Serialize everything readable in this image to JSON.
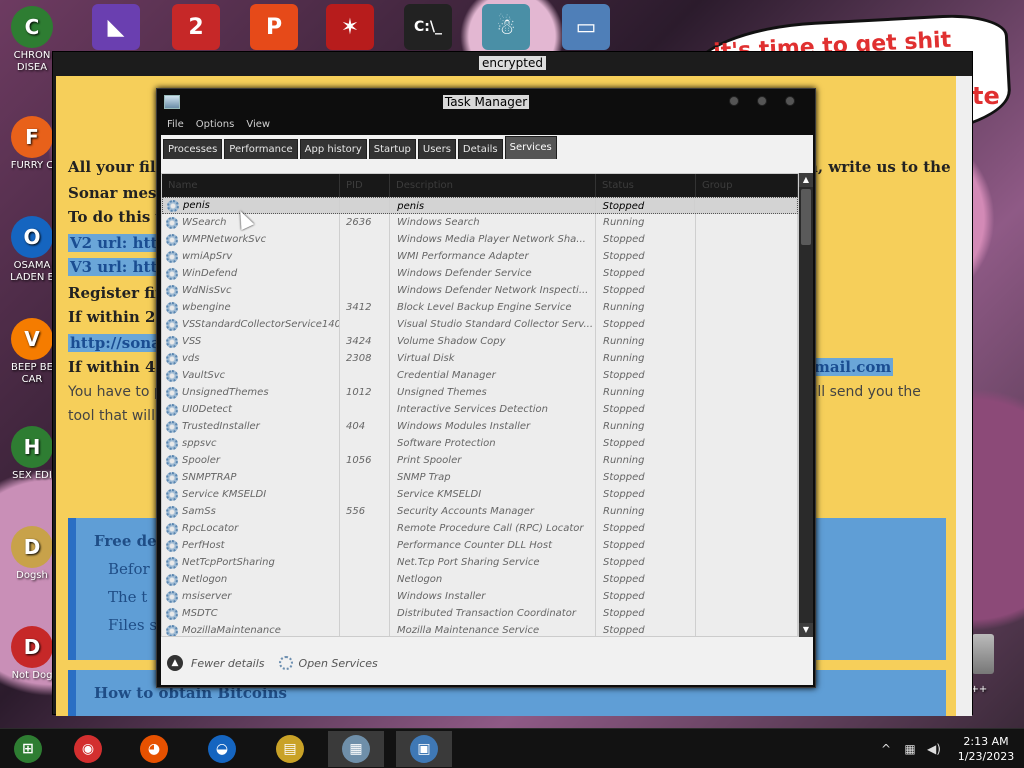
{
  "desktop": {
    "left_icons": [
      {
        "label": "CHRON\nDISEA",
        "icon": "chrome-icon",
        "color": "#2e7d32"
      },
      {
        "label": "FURRY C",
        "icon": "firefox-icon",
        "color": "#e8611a"
      },
      {
        "label": "OSAMA\nLADEN E",
        "icon": "obama-logo-icon",
        "color": "#1565c0"
      },
      {
        "label": "BEEP BE\nCAR",
        "icon": "vlc-cone-icon",
        "color": "#f57c00"
      },
      {
        "label": "SEX EDI",
        "icon": "hxd-icon",
        "color": "#2e7d32"
      },
      {
        "label": "Dogsh",
        "icon": "doge-icon",
        "color": "#c8a24a"
      },
      {
        "label": "Not Dog",
        "icon": "devcpp-icon",
        "color": "#c62828"
      }
    ],
    "top_icons": [
      {
        "name": "visual-studio-icon",
        "glyph": "◣",
        "color": "#6a3fb0"
      },
      {
        "name": "tf2-icon",
        "glyph": "2",
        "color": "#c62828"
      },
      {
        "name": "pinball-icon",
        "glyph": "P",
        "color": "#e64a19"
      },
      {
        "name": "bat-icon",
        "glyph": "✶",
        "color": "#b71c1c"
      },
      {
        "name": "cmd-icon",
        "glyph": "C:\\_",
        "color": "#222222"
      },
      {
        "name": "snowman-icon",
        "glyph": "☃",
        "color": "#4a8fa6"
      },
      {
        "name": "window-app-icon",
        "glyph": "▭",
        "color": "#4f7fb8"
      }
    ],
    "comic_text": "it's time to get shit",
    "right_labels": [
      "te",
      "n C++"
    ]
  },
  "ransom_window": {
    "title": "encrypted",
    "lines": [
      {
        "text": "All your file",
        "tail": "m, write us to the"
      },
      {
        "text": "Sonar messa"
      },
      {
        "text": "To do this yo"
      },
      {
        "text": "V2 url: http",
        "hl": true
      },
      {
        "text": "V3 url: http",
        "hl": true
      },
      {
        "text": "Register firs"
      },
      {
        "text": "If within 24"
      },
      {
        "text": "http://sona",
        "hl": true
      },
      {
        "text": "If within 48",
        "tail": "mail.com"
      },
      {
        "text": "You have to p",
        "tail": "will send you the"
      },
      {
        "text": "tool that will d"
      }
    ],
    "box1": {
      "title": "Free decr",
      "bullets": [
        "Befor",
        "The t",
        "Files s"
      ]
    },
    "box2": {
      "title": "How to obtain Bitcoins"
    }
  },
  "task_manager": {
    "title": "Task Manager",
    "menu": [
      "File",
      "Options",
      "View"
    ],
    "tabs": [
      "Processes",
      "Performance",
      "App history",
      "Startup",
      "Users",
      "Details",
      "Services"
    ],
    "active_tab": "Services",
    "columns": [
      "Name",
      "PID",
      "Description",
      "Status",
      "Group"
    ],
    "services": [
      {
        "name": "penis",
        "pid": "",
        "desc": "penis",
        "status": "Stopped",
        "selected": true
      },
      {
        "name": "WSearch",
        "pid": "2636",
        "desc": "Windows Search",
        "status": "Running"
      },
      {
        "name": "WMPNetworkSvc",
        "pid": "",
        "desc": "Windows Media Player Network Sha...",
        "status": "Stopped"
      },
      {
        "name": "wmiApSrv",
        "pid": "",
        "desc": "WMI Performance Adapter",
        "status": "Stopped"
      },
      {
        "name": "WinDefend",
        "pid": "",
        "desc": "Windows Defender Service",
        "status": "Stopped"
      },
      {
        "name": "WdNisSvc",
        "pid": "",
        "desc": "Windows Defender Network Inspecti...",
        "status": "Stopped"
      },
      {
        "name": "wbengine",
        "pid": "3412",
        "desc": "Block Level Backup Engine Service",
        "status": "Running"
      },
      {
        "name": "VSStandardCollectorService140",
        "pid": "",
        "desc": "Visual Studio Standard Collector Serv...",
        "status": "Stopped"
      },
      {
        "name": "VSS",
        "pid": "3424",
        "desc": "Volume Shadow Copy",
        "status": "Running"
      },
      {
        "name": "vds",
        "pid": "2308",
        "desc": "Virtual Disk",
        "status": "Running"
      },
      {
        "name": "VaultSvc",
        "pid": "",
        "desc": "Credential Manager",
        "status": "Stopped"
      },
      {
        "name": "UnsignedThemes",
        "pid": "1012",
        "desc": "Unsigned Themes",
        "status": "Running"
      },
      {
        "name": "UI0Detect",
        "pid": "",
        "desc": "Interactive Services Detection",
        "status": "Stopped"
      },
      {
        "name": "TrustedInstaller",
        "pid": "404",
        "desc": "Windows Modules Installer",
        "status": "Running"
      },
      {
        "name": "sppsvc",
        "pid": "",
        "desc": "Software Protection",
        "status": "Stopped"
      },
      {
        "name": "Spooler",
        "pid": "1056",
        "desc": "Print Spooler",
        "status": "Running"
      },
      {
        "name": "SNMPTRAP",
        "pid": "",
        "desc": "SNMP Trap",
        "status": "Stopped"
      },
      {
        "name": "Service KMSELDI",
        "pid": "",
        "desc": "Service KMSELDI",
        "status": "Stopped"
      },
      {
        "name": "SamSs",
        "pid": "556",
        "desc": "Security Accounts Manager",
        "status": "Running"
      },
      {
        "name": "RpcLocator",
        "pid": "",
        "desc": "Remote Procedure Call (RPC) Locator",
        "status": "Stopped"
      },
      {
        "name": "PerfHost",
        "pid": "",
        "desc": "Performance Counter DLL Host",
        "status": "Stopped"
      },
      {
        "name": "NetTcpPortSharing",
        "pid": "",
        "desc": "Net.Tcp Port Sharing Service",
        "status": "Stopped"
      },
      {
        "name": "Netlogon",
        "pid": "",
        "desc": "Netlogon",
        "status": "Stopped"
      },
      {
        "name": "msiserver",
        "pid": "",
        "desc": "Windows Installer",
        "status": "Stopped"
      },
      {
        "name": "MSDTC",
        "pid": "",
        "desc": "Distributed Transaction Coordinator",
        "status": "Stopped"
      },
      {
        "name": "MozillaMaintenance",
        "pid": "",
        "desc": "Mozilla Maintenance Service",
        "status": "Stopped"
      }
    ],
    "footer": {
      "fewer_details": "Fewer details",
      "open_services": "Open Services"
    }
  },
  "taskbar": {
    "items": [
      {
        "name": "start-button",
        "glyph": "⊞",
        "color": "#2e7d32"
      },
      {
        "name": "chrome-taskbar-icon",
        "glyph": "◉",
        "color": "#d32f2f"
      },
      {
        "name": "firefox-taskbar-icon",
        "glyph": "◕",
        "color": "#e65100"
      },
      {
        "name": "obama-taskbar-icon",
        "glyph": "◒",
        "color": "#1565c0"
      },
      {
        "name": "file-explorer-taskbar-icon",
        "glyph": "▤",
        "color": "#c9a227"
      },
      {
        "name": "task-manager-taskbar-icon",
        "glyph": "▦",
        "color": "#6f8fa9",
        "active": true
      },
      {
        "name": "remote-app-taskbar-icon",
        "glyph": "▣",
        "color": "#3f78b5",
        "active": true
      }
    ],
    "time": "2:13 AM",
    "date": "1/23/2023"
  }
}
